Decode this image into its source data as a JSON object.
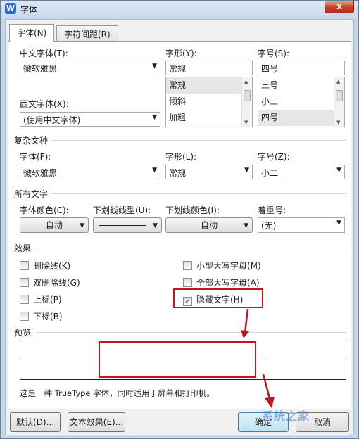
{
  "window": {
    "title": "字体",
    "close_label": "x"
  },
  "tabs": [
    {
      "label": "字体(N)"
    },
    {
      "label": "字符间距(R)"
    }
  ],
  "chinese_font": {
    "label": "中文字体(T):",
    "value": "微软雅黑"
  },
  "font_style": {
    "label": "字形(Y):",
    "value": "常规",
    "options": [
      "常规",
      "倾斜",
      "加粗"
    ],
    "selected": "常规"
  },
  "font_size": {
    "label": "字号(S):",
    "value": "四号",
    "options": [
      "三号",
      "小三",
      "四号"
    ],
    "selected": "四号"
  },
  "western_font": {
    "label": "西文字体(X):",
    "value": "(使用中文字体)"
  },
  "complex": {
    "title": "复杂文种",
    "font_label": "字体(F):",
    "font_value": "微软雅黑",
    "style_label": "字形(L):",
    "style_value": "常规",
    "size_label": "字号(Z):",
    "size_value": "小二"
  },
  "all_text": {
    "title": "所有文字",
    "font_color_label": "字体颜色(C):",
    "font_color_value": "自动",
    "underline_type_label": "下划线线型(U):",
    "underline_color_label": "下划线颜色(I):",
    "underline_color_value": "自动",
    "emphasis_label": "着重号:",
    "emphasis_value": "(无)"
  },
  "effects": {
    "title": "效果",
    "strikethrough": {
      "label": "删除线(K)",
      "checked": false
    },
    "double_strikethrough": {
      "label": "双删除线(G)",
      "checked": false
    },
    "superscript": {
      "label": "上标(P)",
      "checked": false
    },
    "subscript": {
      "label": "下标(B)",
      "checked": false
    },
    "small_caps": {
      "label": "小型大写字母(M)",
      "checked": false
    },
    "all_caps": {
      "label": "全部大写字母(A)",
      "checked": false
    },
    "hidden": {
      "label": "隐藏文字(H)",
      "checked": true
    }
  },
  "preview": {
    "title": "预览",
    "note": "这是一种 TrueType 字体，同时适用于屏幕和打印机。"
  },
  "buttons": {
    "default": "默认(D)...",
    "text_effects": "文本效果(E)...",
    "ok": "确定",
    "cancel": "取消"
  },
  "icons": {
    "check": "✓",
    "dropdown": "▼",
    "up": "▲",
    "down": "▼"
  },
  "watermark": "系统之家",
  "colors": {
    "highlight": "#c0171c"
  }
}
